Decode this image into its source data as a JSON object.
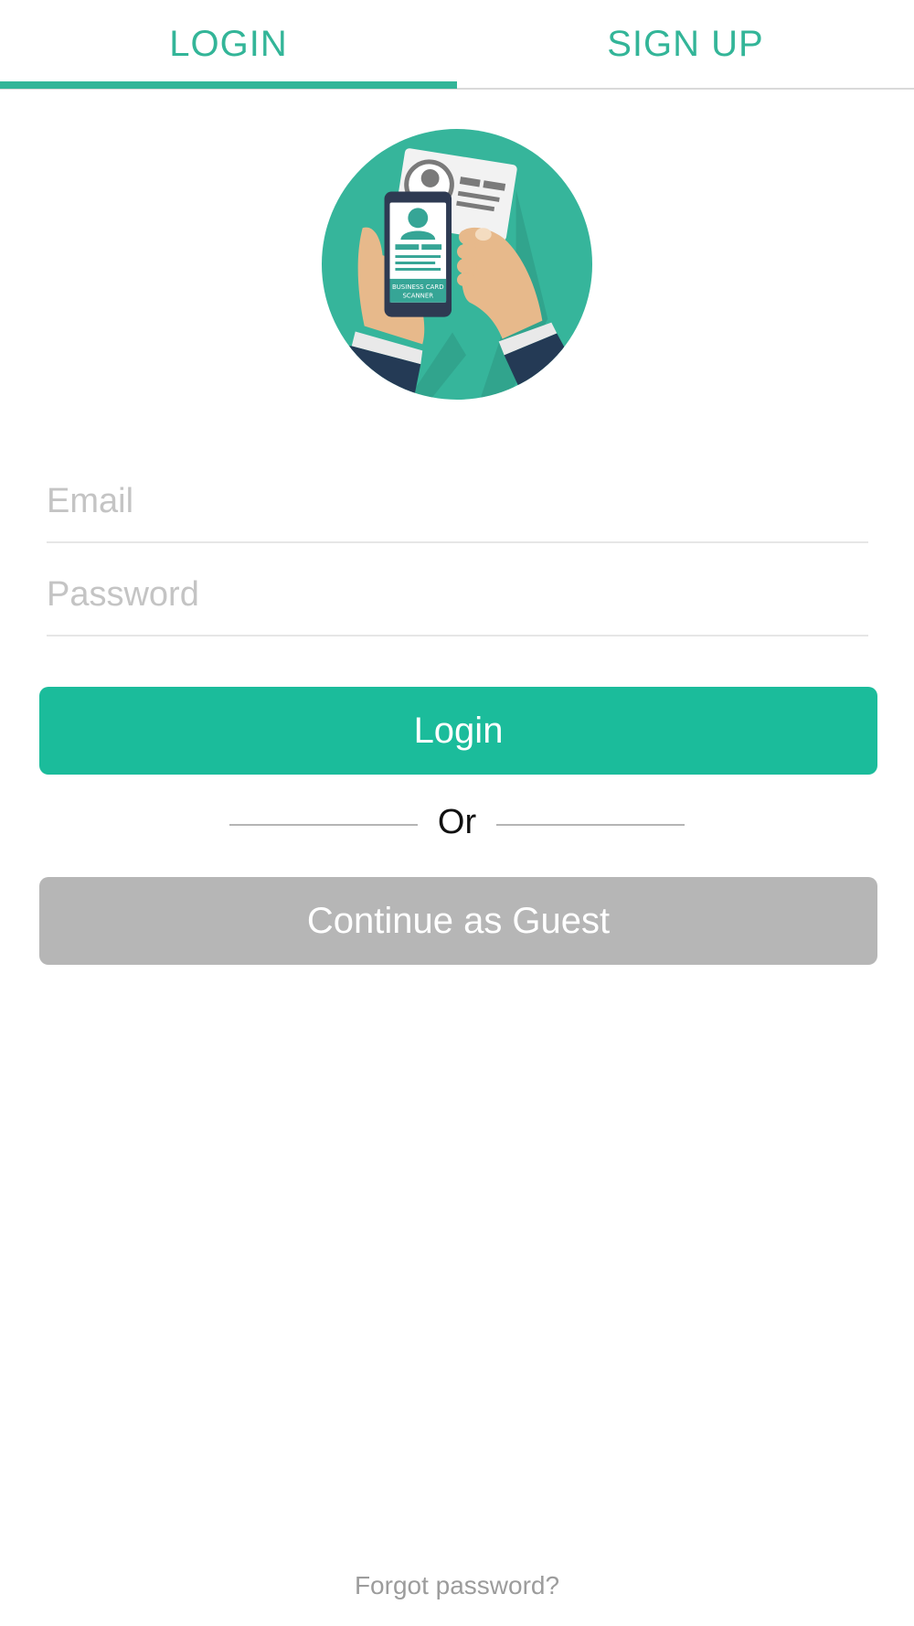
{
  "tabs": [
    {
      "label": "LOGIN",
      "active": true
    },
    {
      "label": "SIGN UP",
      "active": false
    }
  ],
  "logo": {
    "icon": "business-card-scanner-illustration",
    "text_line1": "BUSINESS CARD",
    "text_line2": "SCANNER"
  },
  "form": {
    "email_placeholder": "Email",
    "email_value": "",
    "password_placeholder": "Password",
    "password_value": ""
  },
  "actions": {
    "login_label": "Login",
    "or_label": "Or",
    "guest_label": "Continue as Guest",
    "forgot_label": "Forgot password?"
  },
  "colors": {
    "accent": "#1bbc9b",
    "tab_text": "#33b598",
    "guest_button": "#b6b6b6"
  }
}
